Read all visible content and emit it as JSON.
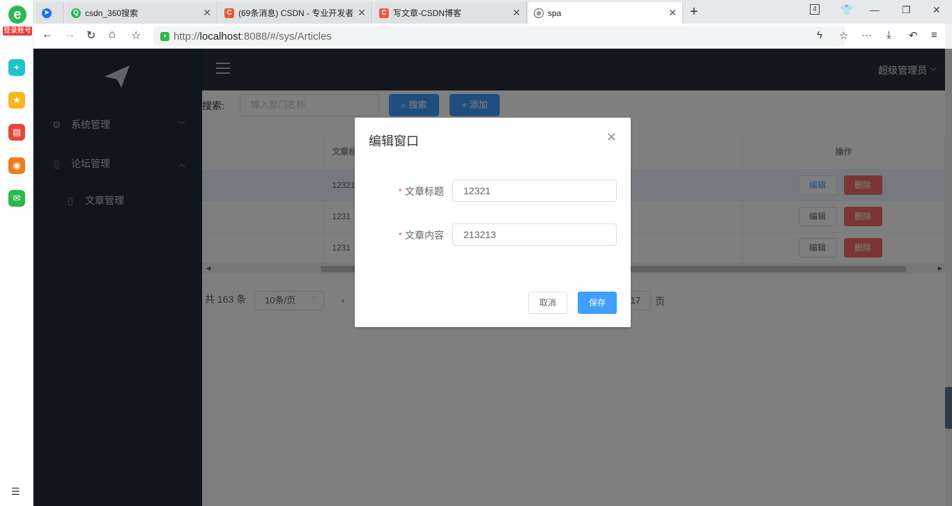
{
  "browser": {
    "login_label": "登录账号",
    "tabs": [
      {
        "title": "",
        "fav_color": "#1a73e8"
      },
      {
        "title": "csdn_360搜索",
        "fav_color": "#2db84d"
      },
      {
        "title": "(69条消息) CSDN - 专业开发者",
        "fav_color": "#f0553b"
      },
      {
        "title": "写文章-CSDN博客",
        "fav_color": "#f0553b"
      },
      {
        "title": "spa",
        "fav_color": "#555555"
      }
    ],
    "tab_count_badge": "4",
    "url_prefix": "http://",
    "url_host": "localhost",
    "url_rest": ":8088/#/sys/Articles"
  },
  "app": {
    "sidebar": {
      "items": [
        {
          "label": "系统管理",
          "icon": "gear-icon"
        },
        {
          "label": "论坛管理",
          "icon": "book-icon"
        }
      ],
      "sub_items": [
        {
          "label": "文章管理",
          "icon": "book-icon"
        }
      ]
    },
    "header": {
      "user": "超级管理员"
    },
    "toolbar": {
      "search_label": "搜索:",
      "search_placeholder": "输入部门名称",
      "search_button": "搜索",
      "add_button": "添加"
    },
    "table": {
      "columns": [
        "文章标",
        "操作"
      ],
      "rows": [
        {
          "title": "12321",
          "edit": "编辑",
          "delete": "删除"
        },
        {
          "title": "1231",
          "edit": "编辑",
          "delete": "删除"
        },
        {
          "title": "1231",
          "edit": "编辑",
          "delete": "删除"
        }
      ]
    },
    "pagination": {
      "total": "共 163 条",
      "page_size": "10条/页",
      "goto_value": "17",
      "goto_suffix": "页"
    }
  },
  "modal": {
    "title": "编辑窗口",
    "fields": [
      {
        "label": "文章标题",
        "value": "12321"
      },
      {
        "label": "文章内容",
        "value": "213213"
      }
    ],
    "cancel": "取消",
    "save": "保存"
  },
  "colors": {
    "primary": "#409eff",
    "danger": "#f56c6c",
    "sidebar": "#1f2d3d"
  }
}
